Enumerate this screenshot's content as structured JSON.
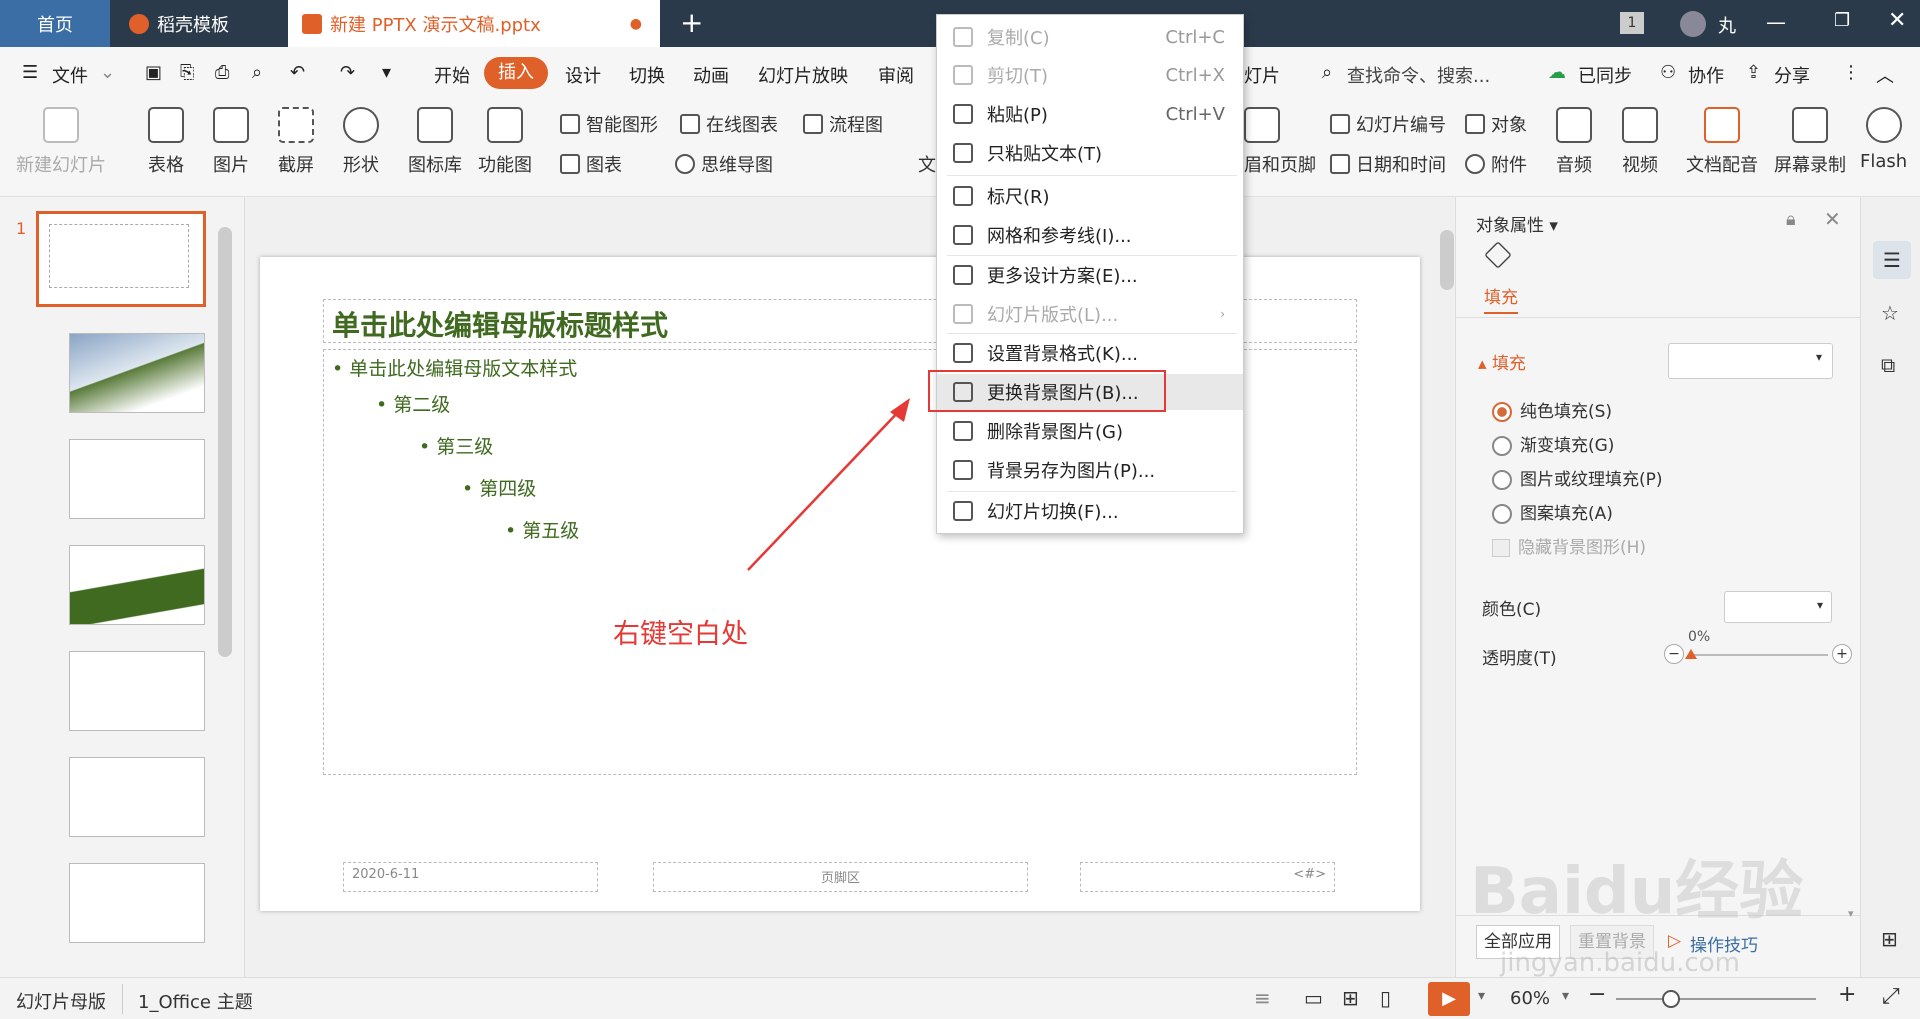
{
  "titlebar": {
    "tab_home": "首页",
    "tab_daoke": "稻壳模板",
    "tab_doc": "新建 PPTX 演示文稿.pptx",
    "badge": "1",
    "user": "丸"
  },
  "menubar": {
    "file": "文件",
    "items": [
      "开始",
      "插入",
      "设计",
      "切换",
      "动画",
      "幻灯片放映",
      "审阅"
    ],
    "search_placeholder": "查找命令、搜索...",
    "synced": "已同步",
    "collab": "协作",
    "share": "分享"
  },
  "ribbon": {
    "new_slide": "新建幻灯片",
    "table": "表格",
    "picture": "图片",
    "screenshot": "截屏",
    "shape": "形状",
    "icon_lib": "图标库",
    "func_chart": "功能图",
    "smart_shape": "智能图形",
    "online_chart": "在线图表",
    "flowchart": "流程图",
    "chart": "图表",
    "mindmap": "思维导图",
    "text_partial": "文",
    "slide_num": "幻灯片编号",
    "object": "对象",
    "header_footer": "眉和页脚",
    "datetime": "日期和时间",
    "attach": "附件",
    "audio": "音频",
    "video": "视频",
    "doc_voice": "文档配音",
    "screen_rec": "屏幕录制",
    "flash": "Flash",
    "slide_lbl_partial": "灯片"
  },
  "slide": {
    "title": "单击此处编辑母版标题样式",
    "levels": [
      "单击此处编辑母版文本样式",
      "第二级",
      "第三级",
      "第四级",
      "第五级"
    ],
    "date": "2020-6-11",
    "footer": "页脚区",
    "num": "<#>",
    "annotation": "右键空白处",
    "thumb_num": "1"
  },
  "context_menu": {
    "items": [
      {
        "label": "复制(C)",
        "shortcut": "Ctrl+C",
        "disabled": true
      },
      {
        "label": "剪切(T)",
        "shortcut": "Ctrl+X",
        "disabled": true
      },
      {
        "label": "粘贴(P)",
        "shortcut": "Ctrl+V",
        "disabled": false
      },
      {
        "label": "只粘贴文本(T)",
        "shortcut": "",
        "disabled": false
      },
      {
        "label": "标尺(R)",
        "shortcut": "",
        "disabled": false
      },
      {
        "label": "网格和参考线(I)...",
        "shortcut": "",
        "disabled": false
      },
      {
        "label": "更多设计方案(E)...",
        "shortcut": "",
        "disabled": false
      },
      {
        "label": "幻灯片版式(L)...",
        "shortcut": "",
        "disabled": true
      },
      {
        "label": "设置背景格式(K)...",
        "shortcut": "",
        "disabled": false
      },
      {
        "label": "更换背景图片(B)...",
        "shortcut": "",
        "disabled": false
      },
      {
        "label": "删除背景图片(G)",
        "shortcut": "",
        "disabled": false
      },
      {
        "label": "背景另存为图片(P)...",
        "shortcut": "",
        "disabled": false
      },
      {
        "label": "幻灯片切换(F)...",
        "shortcut": "",
        "disabled": false
      }
    ]
  },
  "panel": {
    "title": "对象属性",
    "tab_fill": "填充",
    "section_fill": "填充",
    "options": [
      "纯色填充(S)",
      "渐变填充(G)",
      "图片或纹理填充(P)",
      "图案填充(A)"
    ],
    "hide_bg": "隐藏背景图形(H)",
    "color": "颜色(C)",
    "transparency": "透明度(T)",
    "transparency_value": "0%",
    "apply_all": "全部应用",
    "reset_bg": "重置背景",
    "tips": "操作技巧"
  },
  "statusbar": {
    "mode": "幻灯片母版",
    "theme": "1_Office 主题",
    "zoom": "60%"
  },
  "watermark": {
    "text": "Baidu经验",
    "url": "jingyan.baidu.com"
  },
  "colors": {
    "accent": "#e0602a",
    "title_green": "#3f6a1f",
    "red": "#e53935"
  }
}
